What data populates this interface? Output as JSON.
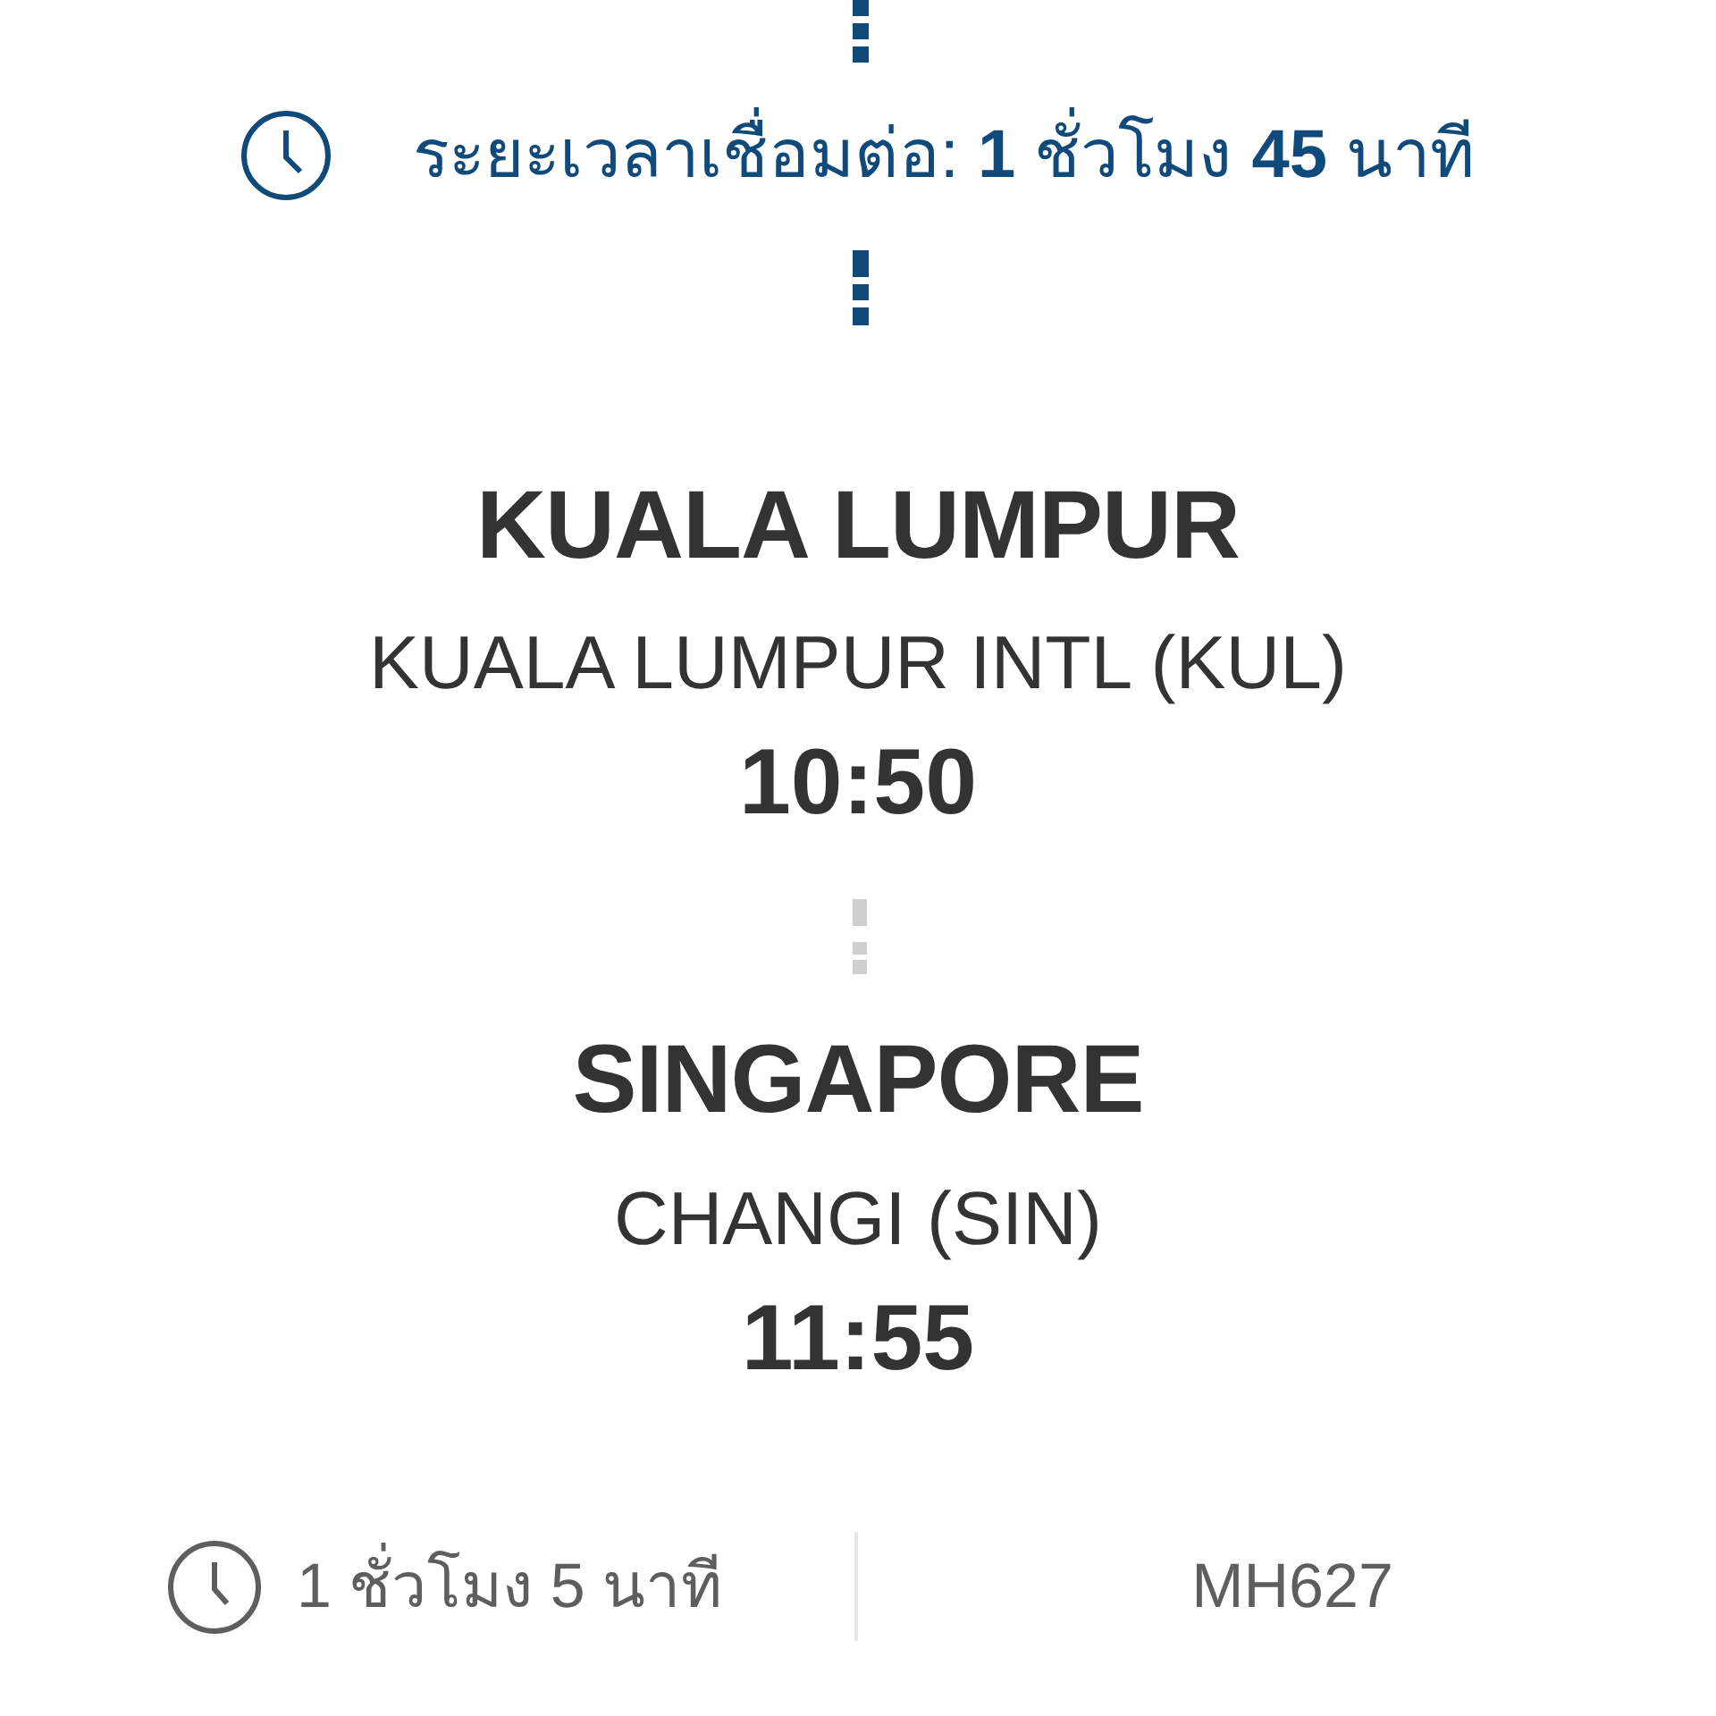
{
  "connection": {
    "text": "ระยะเวลาเชื่อมต่อ: **1** ชั่วโมง **45** นาที"
  },
  "stops": [
    {
      "city": "KUALA LUMPUR",
      "airport": "KUALA LUMPUR INTL (KUL)",
      "time": "10:50"
    },
    {
      "city": "SINGAPORE",
      "airport": "CHANGI (SIN)",
      "time": "11:55"
    }
  ],
  "footer": {
    "duration": "1 ชั่วโมง 5 นาที",
    "flight_number": "MH627"
  }
}
